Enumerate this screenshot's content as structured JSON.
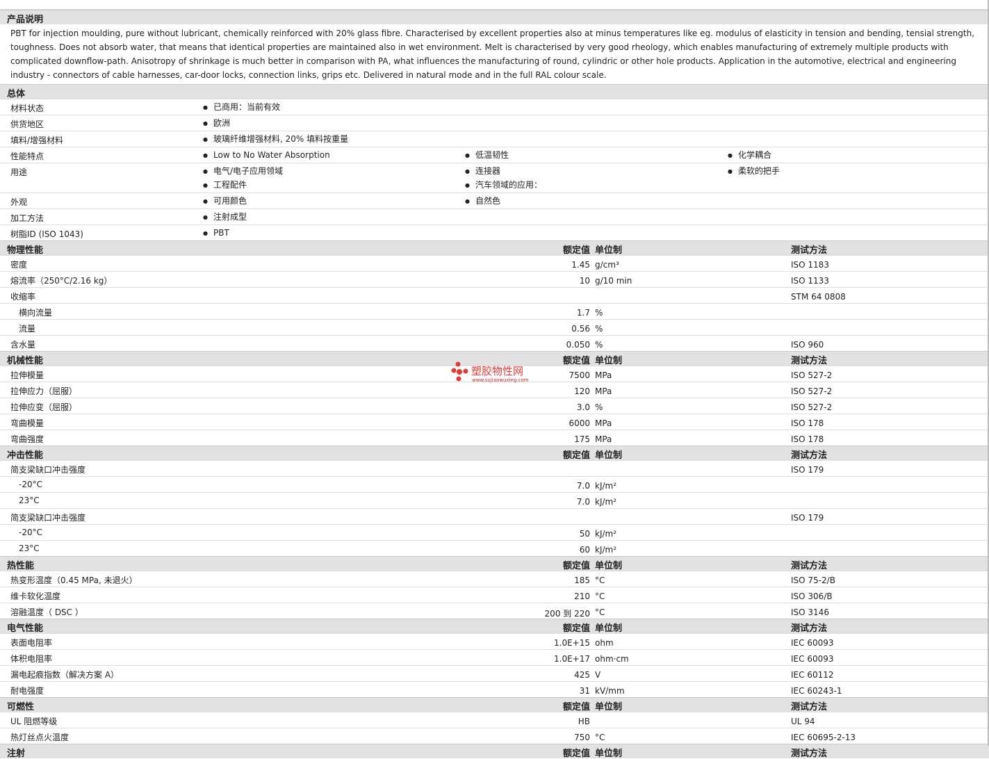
{
  "description": {
    "header": "产品说明",
    "text": "PBT for injection moulding, pure without lubricant, chemically reinforced with 20% glass fibre. Characterised by excellent properties also at minus temperatures like eg. modulus of elasticity in tension and bending, tensial strength, toughness. Does not absorb water, that means that identical properties are maintained also in wet environment. Melt is characterised by very good rheology, which enables manufacturing of extremely multiple products with complicated downflow-path. Anisotropy of shrinkage is much better in comparison with PA, what influences the manufacturing of round, cylindric or other hole products. Application in the automotive, electrical and engineering industry - connectors of cable harnesses, car-door locks, connection links, grips etc. Delivered in natural mode and in the full RAL colour scale."
  },
  "general": {
    "header": "总体",
    "rows": [
      {
        "label": "材料状态",
        "cols": [
          [
            "已商用：当前有效"
          ],
          [],
          []
        ]
      },
      {
        "label": "供货地区",
        "cols": [
          [
            "欧洲"
          ],
          [],
          []
        ]
      },
      {
        "label": "填料/增强材料",
        "cols": [
          [
            "玻璃纤维增强材料, 20% 填料按重量"
          ],
          [],
          []
        ]
      },
      {
        "label": "性能特点",
        "cols": [
          [
            "Low to No Water Absorption"
          ],
          [
            "低温韧性"
          ],
          [
            "化学耦合"
          ]
        ]
      },
      {
        "label": "用途",
        "cols": [
          [
            "电气/电子应用领域",
            "工程配件"
          ],
          [
            "连接器",
            "汽车领域的应用："
          ],
          [
            "柔软的把手"
          ]
        ]
      },
      {
        "label": "外观",
        "cols": [
          [
            "可用颜色"
          ],
          [
            "自然色"
          ],
          []
        ]
      },
      {
        "label": "加工方法",
        "cols": [
          [
            "注射成型"
          ],
          [],
          []
        ]
      },
      {
        "label": "树脂ID (ISO 1043)",
        "cols": [
          [
            "PBT"
          ],
          [],
          []
        ]
      }
    ]
  },
  "col_headers": {
    "value": "额定值",
    "unit": "单位制",
    "test": "测试方法"
  },
  "sections": [
    {
      "title": "物理性能",
      "rows": [
        {
          "label": "密度",
          "value": "1.45",
          "unit": "g/cm³",
          "test": "ISO 1183",
          "sub": false
        },
        {
          "label": "熔流率（250°C/2.16 kg）",
          "value": "10",
          "unit": "g/10 min",
          "test": "ISO 1133",
          "sub": false
        },
        {
          "label": "收缩率",
          "value": "",
          "unit": "",
          "test": "STM 64 0808",
          "sub": false
        },
        {
          "label": "横向流量",
          "value": "1.7",
          "unit": "%",
          "test": "",
          "sub": true
        },
        {
          "label": "流量",
          "value": "0.56",
          "unit": "%",
          "test": "",
          "sub": true
        },
        {
          "label": "含水量",
          "value": "0.050",
          "unit": "%",
          "test": "ISO 960",
          "sub": false
        }
      ]
    },
    {
      "title": "机械性能",
      "rows": [
        {
          "label": "拉伸模量",
          "value": "7500",
          "unit": "MPa",
          "test": "ISO 527-2",
          "sub": false
        },
        {
          "label": "拉伸应力（屈服）",
          "value": "120",
          "unit": "MPa",
          "test": "ISO 527-2",
          "sub": false
        },
        {
          "label": "拉伸应变（屈服）",
          "value": "3.0",
          "unit": "%",
          "test": "ISO 527-2",
          "sub": false
        },
        {
          "label": "弯曲模量",
          "value": "6000",
          "unit": "MPa",
          "test": "ISO 178",
          "sub": false
        },
        {
          "label": "弯曲强度",
          "value": "175",
          "unit": "MPa",
          "test": "ISO 178",
          "sub": false
        }
      ]
    },
    {
      "title": "冲击性能",
      "rows": [
        {
          "label": "简支梁缺口冲击强度",
          "value": "",
          "unit": "",
          "test": "ISO 179",
          "sub": false
        },
        {
          "label": "-20°C",
          "value": "7.0",
          "unit": "kJ/m²",
          "test": "",
          "sub": true
        },
        {
          "label": "23°C",
          "value": "7.0",
          "unit": "kJ/m²",
          "test": "",
          "sub": true
        },
        {
          "label": "简支梁缺口冲击强度",
          "value": "",
          "unit": "",
          "test": "ISO 179",
          "sub": false
        },
        {
          "label": "-20°C",
          "value": "50",
          "unit": "kJ/m²",
          "test": "",
          "sub": true
        },
        {
          "label": "23°C",
          "value": "60",
          "unit": "kJ/m²",
          "test": "",
          "sub": true
        }
      ]
    },
    {
      "title": "热性能",
      "rows": [
        {
          "label": "热变形温度（0.45 MPa, 未退火）",
          "value": "185",
          "unit": "°C",
          "test": "ISO 75-2/B",
          "sub": false
        },
        {
          "label": "维卡软化温度",
          "value": "210",
          "unit": "°C",
          "test": "ISO 306/B",
          "sub": false
        },
        {
          "label": "溶融温度（ DSC ）",
          "value": "200 到 220",
          "unit": "°C",
          "test": "ISO 3146",
          "sub": false
        }
      ]
    },
    {
      "title": "电气性能",
      "rows": [
        {
          "label": "表面电阻率",
          "value": "1.0E+15",
          "unit": "ohm",
          "test": "IEC 60093",
          "sub": false
        },
        {
          "label": "体积电阻率",
          "value": "1.0E+17",
          "unit": "ohm·cm",
          "test": "IEC 60093",
          "sub": false
        },
        {
          "label": "漏电起痕指数（解决方案 A）",
          "value": "425",
          "unit": "V",
          "test": "IEC 60112",
          "sub": false
        },
        {
          "label": "耐电强度",
          "value": "31",
          "unit": "kV/mm",
          "test": "IEC 60243-1",
          "sub": false
        }
      ]
    },
    {
      "title": "可燃性",
      "rows": [
        {
          "label": "UL 阻燃等级",
          "value": "HB",
          "unit": "",
          "test": "UL 94",
          "sub": false
        },
        {
          "label": "热灯丝点火温度",
          "value": "750",
          "unit": "°C",
          "test": "IEC 60695-2-13",
          "sub": false
        }
      ]
    },
    {
      "title": "注射",
      "rows": []
    }
  ],
  "watermark": {
    "text": "塑胶物性网",
    "url": "www.sujiaowuxing.com",
    "color": "#e53935"
  }
}
